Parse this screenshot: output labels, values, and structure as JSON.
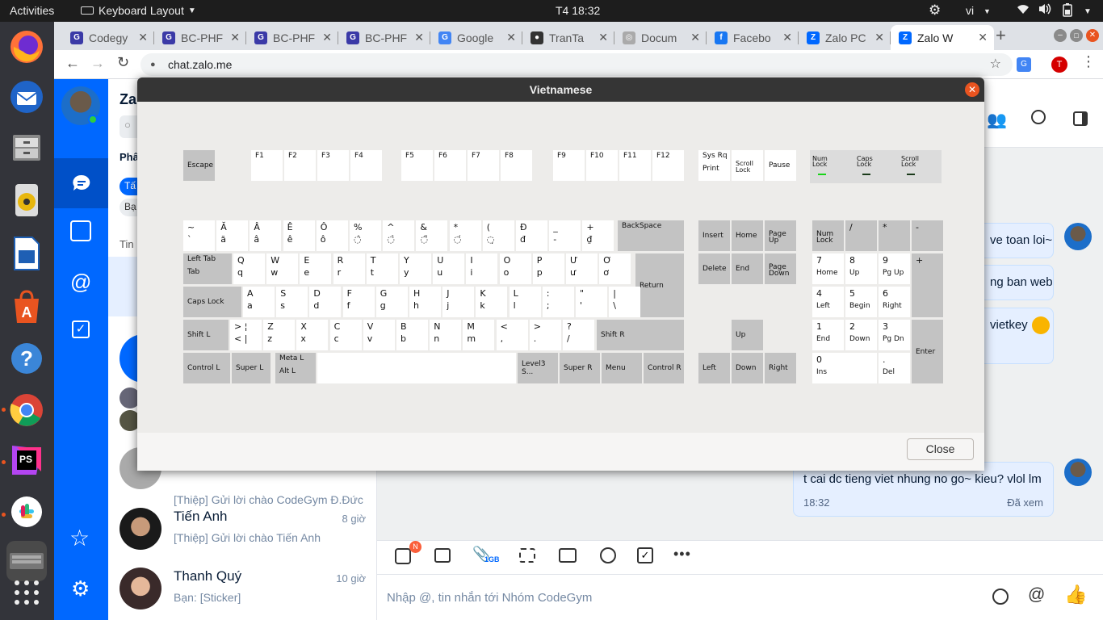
{
  "top_bar": {
    "activities": "Activities",
    "app_menu": "Keyboard Layout",
    "clock": "T4 18:32",
    "lang": "vi"
  },
  "browser": {
    "tabs": [
      {
        "title": "Codegy",
        "fav": "G",
        "color": "#3b3aa7"
      },
      {
        "title": "BC-PHF",
        "fav": "G",
        "color": "#3b3aa7"
      },
      {
        "title": "BC-PHF",
        "fav": "G",
        "color": "#3b3aa7"
      },
      {
        "title": "BC-PHF",
        "fav": "G",
        "color": "#3b3aa7"
      },
      {
        "title": "Google",
        "fav": "G",
        "color": "#4285f4"
      },
      {
        "title": "TranTa",
        "fav": "●",
        "color": "#333333"
      },
      {
        "title": "Docum",
        "fav": "◎",
        "color": "#aaaaaa"
      },
      {
        "title": "Facebo",
        "fav": "f",
        "color": "#1877f2"
      },
      {
        "title": "Zalo PC",
        "fav": "Z",
        "color": "#0068ff"
      },
      {
        "title": "Zalo W",
        "fav": "Z",
        "color": "#0068ff",
        "active": true
      }
    ],
    "url": "chat.zalo.me",
    "profile_letter": "T"
  },
  "zalo": {
    "header_title": "Zal",
    "section": "Phâ",
    "chip1": "Tấ",
    "chip2": "Bạ",
    "tin": "Tin",
    "conversations": [
      {
        "name": "Tiến Anh",
        "time": "8 giờ",
        "msg": "[Thiệp] Gửi lời chào Tiến Anh"
      },
      {
        "name": "Thanh Quý",
        "time": "10 giờ",
        "msg": "Bạn: [Sticker]"
      }
    ],
    "partial_msg": "[Thiệp] Gửi lời chào CodeGym Đ.Đức",
    "messages": [
      {
        "text": "ve toan loi~"
      },
      {
        "text": "ng ban web"
      },
      {
        "text": "vietkey"
      }
    ],
    "last_message": {
      "text": "t cai dc tieng viet nhung no go~ kieu? vlol lm",
      "time": "18:32",
      "status": "Đã xem"
    },
    "composer_placeholder": "Nhập @, tin nhắn tới Nhóm CodeGym",
    "badge": "N",
    "attach_size": "1GB"
  },
  "dialog": {
    "title": "Vietnamese",
    "close_label": "Close"
  },
  "keyboard": {
    "fkeys": {
      "esc": "Escape",
      "f1": "F1",
      "f2": "F2",
      "f3": "F3",
      "f4": "F4",
      "f5": "F5",
      "f6": "F6",
      "f7": "F7",
      "f8": "F8",
      "f9": "F9",
      "f10": "F10",
      "f11": "F11",
      "f12": "F12",
      "sysrq_1": "Sys Rq",
      "sysrq_2": "Print",
      "scroll_1": "Scroll",
      "scroll_2": "Lock",
      "pause": "Pause"
    },
    "leds": {
      "num_1": "Num",
      "num_2": "Lock",
      "caps_1": "Caps",
      "caps_2": "Lock",
      "scroll_1": "Scroll",
      "scroll_2": "Lock"
    },
    "row1": [
      {
        "s": "~",
        "u": "`"
      },
      {
        "s": "Ă",
        "u": "ă"
      },
      {
        "s": "Â",
        "u": "â"
      },
      {
        "s": "Ê",
        "u": "ê"
      },
      {
        "s": "Ô",
        "u": "ô"
      },
      {
        "s": "%",
        "u": "◌̀"
      },
      {
        "s": "^",
        "u": "◌̉"
      },
      {
        "s": "&",
        "u": "◌̃"
      },
      {
        "s": "*",
        "u": "◌́"
      },
      {
        "s": "(",
        "u": "◌̣"
      },
      {
        "s": "Đ",
        "u": "đ"
      },
      {
        "s": "_",
        "u": "-"
      },
      {
        "s": "+",
        "u": "₫"
      }
    ],
    "row1_extra": [
      "d...",
      "~",
      "´",
      "."
    ],
    "backspace": "BackSpace",
    "tab_1": "Left Tab",
    "tab_2": "Tab",
    "row2": [
      {
        "s": "Q",
        "u": "q"
      },
      {
        "s": "W",
        "u": "w"
      },
      {
        "s": "E",
        "u": "e"
      },
      {
        "s": "R",
        "u": "r"
      },
      {
        "s": "T",
        "u": "t"
      },
      {
        "s": "Y",
        "u": "y"
      },
      {
        "s": "U",
        "u": "u"
      },
      {
        "s": "I",
        "u": "i"
      },
      {
        "s": "O",
        "u": "o"
      },
      {
        "s": "P",
        "u": "p"
      },
      {
        "s": "Ư",
        "u": "ư"
      },
      {
        "s": "Ơ",
        "u": "ơ"
      }
    ],
    "caps": "Caps Lock",
    "row3": [
      {
        "s": "A",
        "u": "a"
      },
      {
        "s": "S",
        "u": "s"
      },
      {
        "s": "D",
        "u": "d"
      },
      {
        "s": "F",
        "u": "f"
      },
      {
        "s": "G",
        "u": "g"
      },
      {
        "s": "H",
        "u": "h"
      },
      {
        "s": "J",
        "u": "j"
      },
      {
        "s": "K",
        "u": "k"
      },
      {
        "s": "L",
        "u": "l"
      },
      {
        "s": ":",
        "u": ";"
      },
      {
        "s": "\"",
        "u": "'"
      },
      {
        "s": "|",
        "u": "\\"
      }
    ],
    "return": "Return",
    "shiftl": "Shift L",
    "row4": [
      {
        "s": ">  ¦",
        "u": "<  |"
      },
      {
        "s": "Z",
        "u": "z"
      },
      {
        "s": "X",
        "u": "x"
      },
      {
        "s": "C",
        "u": "c"
      },
      {
        "s": "V",
        "u": "v"
      },
      {
        "s": "B",
        "u": "b"
      },
      {
        "s": "N",
        "u": "n"
      },
      {
        "s": "M",
        "u": "m"
      },
      {
        "s": "<",
        "u": ","
      },
      {
        "s": ">",
        "u": "."
      },
      {
        "s": "?",
        "u": "/"
      }
    ],
    "shiftr": "Shift R",
    "ctrll": "Control L",
    "superl": "Super L",
    "meta_1": "Meta L",
    "meta_2": "Alt L",
    "lvl3": "Level3 S...",
    "superr": "Super R",
    "menu": "Menu",
    "ctrlr": "Control R",
    "nav": {
      "insert": "Insert",
      "home": "Home",
      "pgup_1": "Page",
      "pgup_2": "Up",
      "delete": "Delete",
      "end": "End",
      "pgdn_1": "Page",
      "pgdn_2": "Down",
      "up": "Up",
      "left": "Left",
      "down": "Down",
      "right": "Right"
    },
    "numpad": {
      "nl_1": "Num",
      "nl_2": "Lock",
      "div": "/",
      "mul": "*",
      "sub": "-",
      "add": "+",
      "enter": "Enter",
      "k7": {
        "t": "7",
        "b": "Home"
      },
      "k8": {
        "t": "8",
        "b": "Up"
      },
      "k9": {
        "t": "9",
        "b": "Pg Up"
      },
      "k4": {
        "t": "4",
        "b": "Left"
      },
      "k5": {
        "t": "5",
        "b": "Begin"
      },
      "k6": {
        "t": "6",
        "b": "Right"
      },
      "k1": {
        "t": "1",
        "b": "End"
      },
      "k2": {
        "t": "2",
        "b": "Down"
      },
      "k3": {
        "t": "3",
        "b": "Pg Dn"
      },
      "k0": {
        "t": "0",
        "b": "Ins"
      },
      "kdot": {
        "t": ".",
        "b": "Del"
      }
    }
  },
  "colors": {
    "ubuntu_orange": "#e95420",
    "zalo_blue": "#0068ff",
    "led_on": "#18d418"
  }
}
